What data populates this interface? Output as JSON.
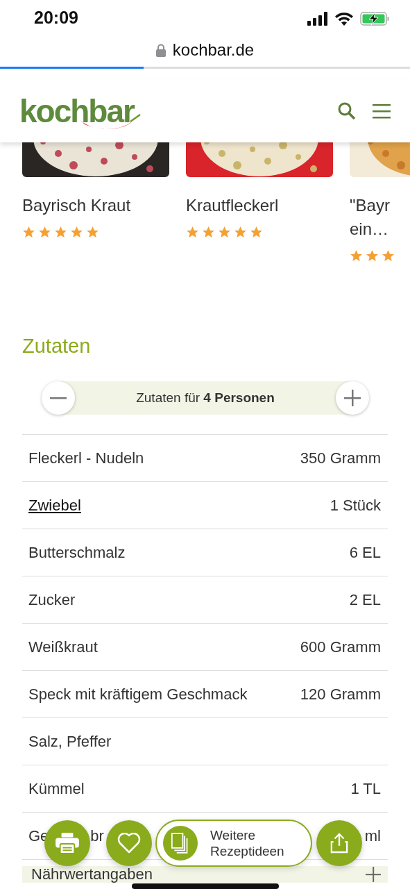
{
  "status_bar": {
    "time": "20:09"
  },
  "browser": {
    "url": "kochbar.de",
    "progress": {
      "level": 0.35
    }
  },
  "header": {
    "logo": "kochbar"
  },
  "recipe_cards": [
    {
      "title": "Bayrisch Kraut",
      "stars": 5,
      "kind": "picture"
    },
    {
      "title": "Krautfleckerl",
      "stars": 5,
      "kind": "picture"
    },
    {
      "title": "\"Bayr ein…",
      "stars": 3,
      "kind": "picture"
    }
  ],
  "ingredients": {
    "heading": "Zutaten",
    "servings": "Zutaten für **4 Personen**",
    "rows": [
      {
        "name": "Fleckerl - Nudeln",
        "amount": "350 Gramm",
        "kind": "text"
      },
      {
        "name": "Zwiebel",
        "amount": "1 Stück",
        "kind": "link"
      },
      {
        "name": "Butterschmalz",
        "amount": "6 EL",
        "kind": "text"
      },
      {
        "name": "Zucker",
        "amount": "2 EL",
        "kind": "text"
      },
      {
        "name": "Weißkraut",
        "amount": "600 Gramm",
        "kind": "text"
      },
      {
        "name": "Speck mit kräftigem Geschmack",
        "amount": "120 Gramm",
        "kind": "text"
      },
      {
        "name": "Salz, Pfeffer",
        "kind": "text"
      },
      {
        "name": "Kümmel",
        "amount": "1 TL",
        "kind": "text"
      },
      {
        "name_parts": [
          "Ge",
          "br"
        ],
        "amount": "ml",
        "kind": "covered"
      }
    ]
  },
  "nutrition": {
    "label": "Nährwertangaben"
  },
  "action_bar": {
    "more_ideas": "Weitere Rezeptideen"
  }
}
